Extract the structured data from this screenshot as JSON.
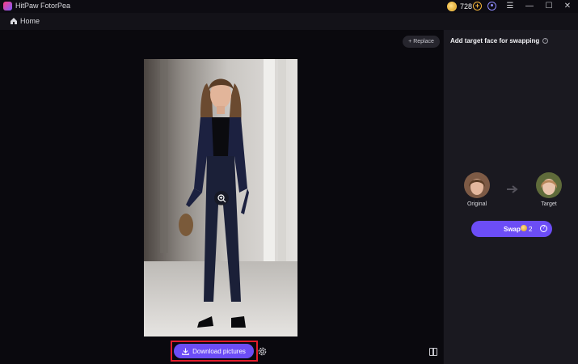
{
  "app": {
    "title": "HitPaw FotorPea"
  },
  "titlebar": {
    "coins": "728",
    "add_coins_symbol": "+",
    "menu_symbol": "☰",
    "minimize_symbol": "—",
    "maximize_symbol": "☐",
    "close_symbol": "✕"
  },
  "nav": {
    "home_label": "Home"
  },
  "canvas": {
    "replace_label": "Replace",
    "download_label": "Download pictures"
  },
  "panel": {
    "title": "Add target face for swapping",
    "original_label": "Original",
    "target_label": "Target",
    "swap_label": "Swap",
    "swap_cost": "2",
    "help_symbol": "?"
  },
  "colors": {
    "accent": "#6c4df6",
    "highlight_border": "#e21d2b",
    "background": "#0a090e",
    "panel": "#1a1920"
  },
  "icons": [
    "app-logo",
    "coin-icon",
    "add-coin-icon",
    "user-icon",
    "menu-icon",
    "minimize-icon",
    "maximize-icon",
    "close-icon",
    "home-icon",
    "plus-icon",
    "zoom-in-icon",
    "download-icon",
    "settings-icon",
    "compare-icon",
    "info-icon",
    "arrow-right-icon",
    "help-icon"
  ]
}
